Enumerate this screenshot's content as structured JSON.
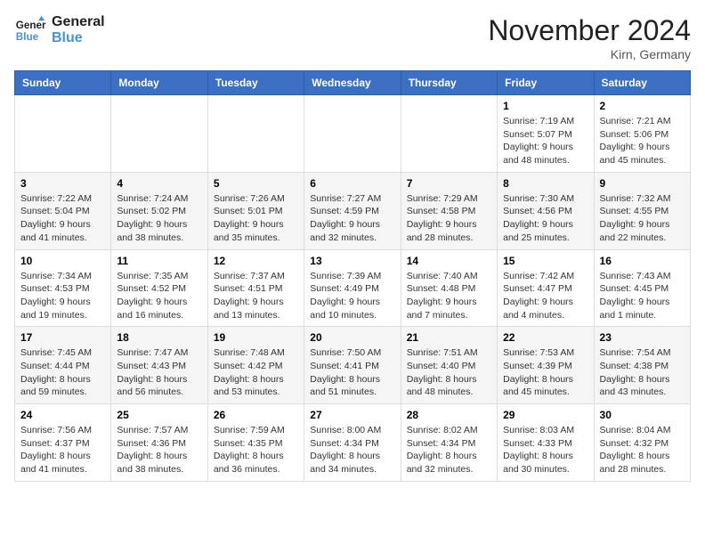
{
  "logo": {
    "line1": "General",
    "line2": "Blue"
  },
  "title": "November 2024",
  "location": "Kirn, Germany",
  "weekdays": [
    "Sunday",
    "Monday",
    "Tuesday",
    "Wednesday",
    "Thursday",
    "Friday",
    "Saturday"
  ],
  "weeks": [
    [
      {
        "day": "",
        "info": ""
      },
      {
        "day": "",
        "info": ""
      },
      {
        "day": "",
        "info": ""
      },
      {
        "day": "",
        "info": ""
      },
      {
        "day": "",
        "info": ""
      },
      {
        "day": "1",
        "info": "Sunrise: 7:19 AM\nSunset: 5:07 PM\nDaylight: 9 hours and 48 minutes."
      },
      {
        "day": "2",
        "info": "Sunrise: 7:21 AM\nSunset: 5:06 PM\nDaylight: 9 hours and 45 minutes."
      }
    ],
    [
      {
        "day": "3",
        "info": "Sunrise: 7:22 AM\nSunset: 5:04 PM\nDaylight: 9 hours and 41 minutes."
      },
      {
        "day": "4",
        "info": "Sunrise: 7:24 AM\nSunset: 5:02 PM\nDaylight: 9 hours and 38 minutes."
      },
      {
        "day": "5",
        "info": "Sunrise: 7:26 AM\nSunset: 5:01 PM\nDaylight: 9 hours and 35 minutes."
      },
      {
        "day": "6",
        "info": "Sunrise: 7:27 AM\nSunset: 4:59 PM\nDaylight: 9 hours and 32 minutes."
      },
      {
        "day": "7",
        "info": "Sunrise: 7:29 AM\nSunset: 4:58 PM\nDaylight: 9 hours and 28 minutes."
      },
      {
        "day": "8",
        "info": "Sunrise: 7:30 AM\nSunset: 4:56 PM\nDaylight: 9 hours and 25 minutes."
      },
      {
        "day": "9",
        "info": "Sunrise: 7:32 AM\nSunset: 4:55 PM\nDaylight: 9 hours and 22 minutes."
      }
    ],
    [
      {
        "day": "10",
        "info": "Sunrise: 7:34 AM\nSunset: 4:53 PM\nDaylight: 9 hours and 19 minutes."
      },
      {
        "day": "11",
        "info": "Sunrise: 7:35 AM\nSunset: 4:52 PM\nDaylight: 9 hours and 16 minutes."
      },
      {
        "day": "12",
        "info": "Sunrise: 7:37 AM\nSunset: 4:51 PM\nDaylight: 9 hours and 13 minutes."
      },
      {
        "day": "13",
        "info": "Sunrise: 7:39 AM\nSunset: 4:49 PM\nDaylight: 9 hours and 10 minutes."
      },
      {
        "day": "14",
        "info": "Sunrise: 7:40 AM\nSunset: 4:48 PM\nDaylight: 9 hours and 7 minutes."
      },
      {
        "day": "15",
        "info": "Sunrise: 7:42 AM\nSunset: 4:47 PM\nDaylight: 9 hours and 4 minutes."
      },
      {
        "day": "16",
        "info": "Sunrise: 7:43 AM\nSunset: 4:45 PM\nDaylight: 9 hours and 1 minute."
      }
    ],
    [
      {
        "day": "17",
        "info": "Sunrise: 7:45 AM\nSunset: 4:44 PM\nDaylight: 8 hours and 59 minutes."
      },
      {
        "day": "18",
        "info": "Sunrise: 7:47 AM\nSunset: 4:43 PM\nDaylight: 8 hours and 56 minutes."
      },
      {
        "day": "19",
        "info": "Sunrise: 7:48 AM\nSunset: 4:42 PM\nDaylight: 8 hours and 53 minutes."
      },
      {
        "day": "20",
        "info": "Sunrise: 7:50 AM\nSunset: 4:41 PM\nDaylight: 8 hours and 51 minutes."
      },
      {
        "day": "21",
        "info": "Sunrise: 7:51 AM\nSunset: 4:40 PM\nDaylight: 8 hours and 48 minutes."
      },
      {
        "day": "22",
        "info": "Sunrise: 7:53 AM\nSunset: 4:39 PM\nDaylight: 8 hours and 45 minutes."
      },
      {
        "day": "23",
        "info": "Sunrise: 7:54 AM\nSunset: 4:38 PM\nDaylight: 8 hours and 43 minutes."
      }
    ],
    [
      {
        "day": "24",
        "info": "Sunrise: 7:56 AM\nSunset: 4:37 PM\nDaylight: 8 hours and 41 minutes."
      },
      {
        "day": "25",
        "info": "Sunrise: 7:57 AM\nSunset: 4:36 PM\nDaylight: 8 hours and 38 minutes."
      },
      {
        "day": "26",
        "info": "Sunrise: 7:59 AM\nSunset: 4:35 PM\nDaylight: 8 hours and 36 minutes."
      },
      {
        "day": "27",
        "info": "Sunrise: 8:00 AM\nSunset: 4:34 PM\nDaylight: 8 hours and 34 minutes."
      },
      {
        "day": "28",
        "info": "Sunrise: 8:02 AM\nSunset: 4:34 PM\nDaylight: 8 hours and 32 minutes."
      },
      {
        "day": "29",
        "info": "Sunrise: 8:03 AM\nSunset: 4:33 PM\nDaylight: 8 hours and 30 minutes."
      },
      {
        "day": "30",
        "info": "Sunrise: 8:04 AM\nSunset: 4:32 PM\nDaylight: 8 hours and 28 minutes."
      }
    ]
  ]
}
